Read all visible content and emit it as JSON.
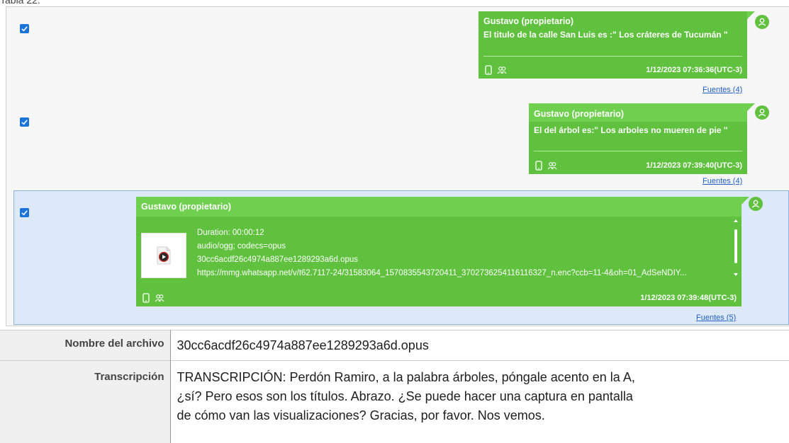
{
  "caption": "Tabla 22.",
  "messages": [
    {
      "author": "Gustavo (propietario)",
      "text": "El titulo de la calle San Luis es :\" Los cráteres de Tucumán \"",
      "timestamp": "1/12/2023 07:36:36(UTC-3)",
      "sources": "Fuentes (4)",
      "checked": true
    },
    {
      "author": "Gustavo (propietario)",
      "text": "El del árbol es:\" Los arboles no mueren de pie \"",
      "timestamp": "1/12/2023 07:39:40(UTC-3)",
      "sources": "Fuentes (4)",
      "checked": true
    },
    {
      "author": "Gustavo (propietario)",
      "duration": "Duration: 00:00:12",
      "mime": "audio/ogg; codecs=opus",
      "filename": "30cc6acdf26c4974a887ee1289293a6d.opus",
      "url": "https://mmg.whatsapp.net/v/t62.7117-24/31583064_1570835543720411_3702736254116116327_n.enc?ccb=11-4&oh=01_AdSeNDIY...",
      "timestamp": "1/12/2023 07:39:48(UTC-3)",
      "sources": "Fuentes (5)",
      "checked": true,
      "selected": true
    }
  ],
  "details": [
    {
      "label": "Nombre del archivo",
      "value": "30cc6acdf26c4974a887ee1289293a6d.opus"
    },
    {
      "label": "Transcripción",
      "lines": [
        "TRANSCRIPCIÓN: Perdón Ramiro, a la palabra árboles, póngale acento en la A,",
        "¿sí? Pero esos son los títulos. Abrazo. ¿Se puede hacer una captura en pantalla",
        "de cómo van las visualizaciones? Gracias, por favor. Nos vemos."
      ]
    }
  ],
  "colors": {
    "bubble": "#5fc13e",
    "bubble_header": "#6fcf4f",
    "checkbox": "#1a73d9",
    "selected_row": "#dde8f8",
    "link": "#1f5fc4"
  },
  "icons": [
    "check-icon",
    "user-avatar-icon",
    "phone-icon",
    "group-icon",
    "play-icon"
  ]
}
